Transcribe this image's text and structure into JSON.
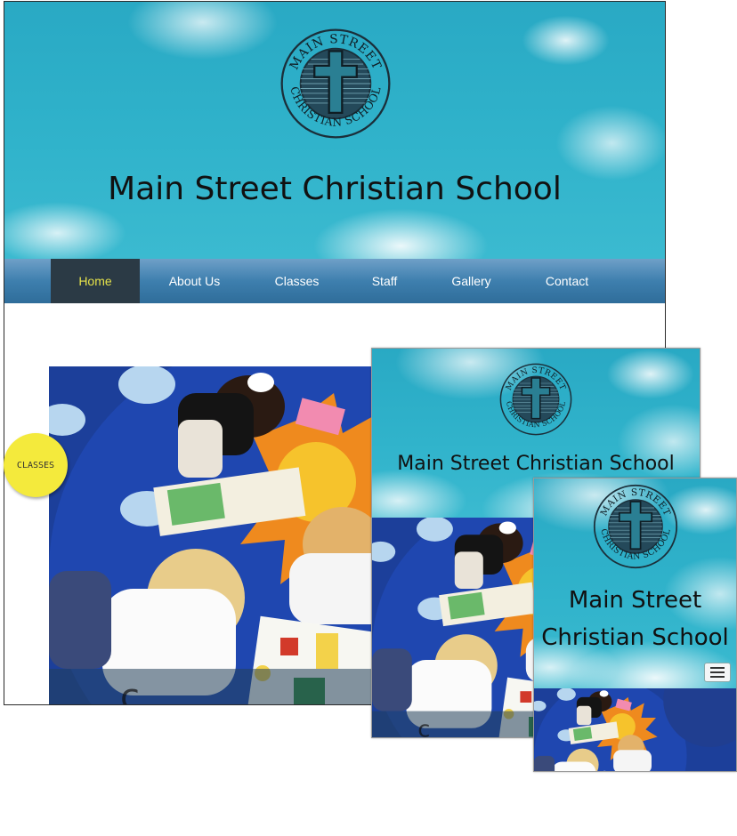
{
  "logo": {
    "text_top": "MAIN STREET",
    "text_bottom": "CHRISTIAN SCHOOL",
    "icon": "cross-seal-icon"
  },
  "site_title": "Main Street Christian School",
  "nav": {
    "items": [
      {
        "label": "Home",
        "active": true
      },
      {
        "label": "About Us",
        "active": false
      },
      {
        "label": "Classes",
        "active": false
      },
      {
        "label": "Staff",
        "active": false
      },
      {
        "label": "Gallery",
        "active": false
      },
      {
        "label": "Contact",
        "active": false
      }
    ]
  },
  "badge": {
    "label": "CLASSES"
  },
  "mobile_menu": {
    "icon": "hamburger-menu-icon"
  },
  "colors": {
    "sky": "#30b3cb",
    "nav_bar": "#3e7fae",
    "nav_active_bg": "#2b3a45",
    "nav_active_text": "#e6e34a",
    "badge": "#f4ea3c",
    "logo": "#1b2f3a"
  }
}
